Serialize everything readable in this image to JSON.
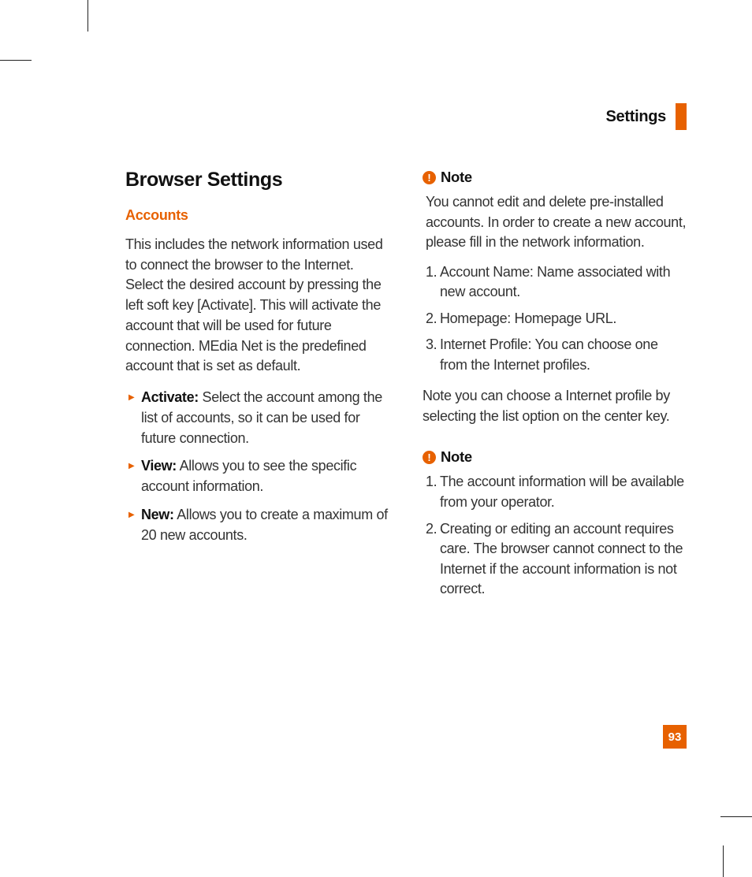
{
  "header": {
    "title": "Settings"
  },
  "page_number": "93",
  "left": {
    "h1": "Browser Settings",
    "h2": "Accounts",
    "intro": "This includes the network information used to connect the browser to the Internet. Select the desired account by pressing the left soft key [Activate]. This will activate the account that will be used for future connection. MEdia Net is the predefined account that is set as default.",
    "bullets": [
      {
        "label": "Activate:",
        "text": " Select the account among the list of accounts, so it can be used for future connection."
      },
      {
        "label": "View:",
        "text": " Allows you to see the specific account information."
      },
      {
        "label": "New:",
        "text": " Allows you to create a maximum of 20 new accounts."
      }
    ]
  },
  "right": {
    "note1": {
      "label": "Note",
      "body": "You cannot edit and delete pre-installed accounts. In order to create a new account, please fill in the network information.",
      "items": [
        {
          "n": "1.",
          "t": "Account Name: Name associated with new account."
        },
        {
          "n": "2.",
          "t": "Homepage: Homepage URL."
        },
        {
          "n": "3.",
          "t": "Internet Profile: You can choose one from the Internet profiles."
        }
      ],
      "after": "Note you can choose a Internet profile by selecting the list option on the center key."
    },
    "note2": {
      "label": "Note",
      "items": [
        {
          "n": "1.",
          "t": "The account information will be available from your operator."
        },
        {
          "n": "2.",
          "t": "Creating or editing an account requires care. The browser cannot connect to the Internet if the account information is not correct."
        }
      ]
    }
  }
}
